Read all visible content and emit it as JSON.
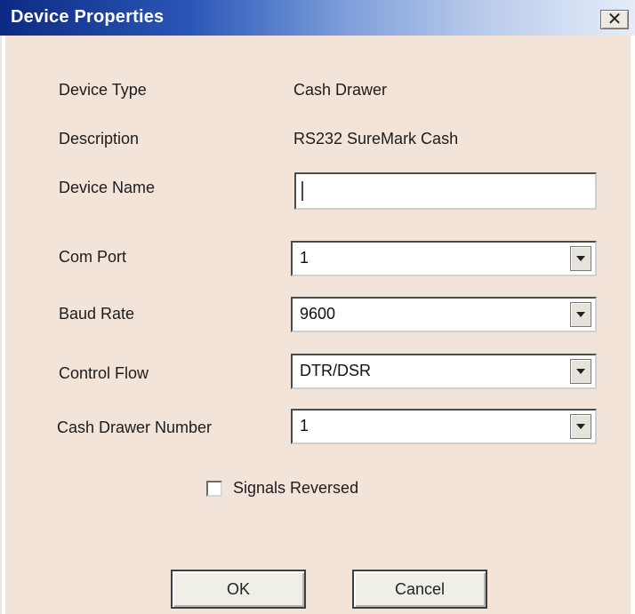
{
  "window": {
    "title": "Device Properties",
    "close_label": "✕"
  },
  "fields": {
    "device_type": {
      "label": "Device Type",
      "value": "Cash Drawer"
    },
    "description": {
      "label": "Description",
      "value": "RS232 SureMark Cash"
    },
    "device_name": {
      "label": "Device Name",
      "value": ""
    },
    "com_port": {
      "label": "Com Port",
      "value": "1"
    },
    "baud_rate": {
      "label": "Baud Rate",
      "value": "9600"
    },
    "control_flow": {
      "label": "Control Flow",
      "value": "DTR/DSR"
    },
    "cash_drawer_number": {
      "label": "Cash Drawer Number",
      "value": "1"
    }
  },
  "options": {
    "signals_reversed": {
      "label": "Signals Reversed",
      "checked": false
    }
  },
  "buttons": {
    "ok": "OK",
    "cancel": "Cancel"
  }
}
